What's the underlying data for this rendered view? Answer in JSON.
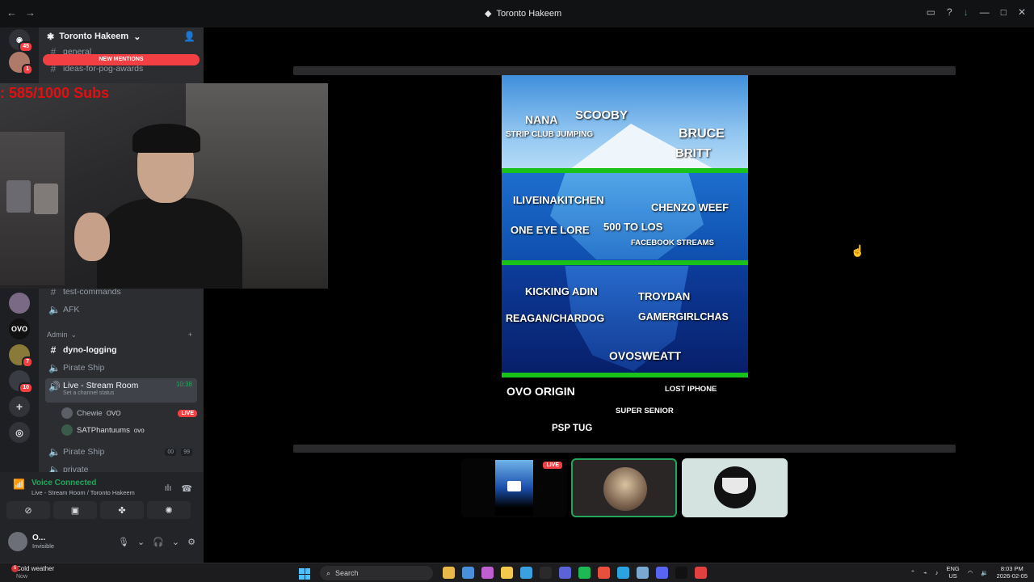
{
  "window": {
    "title": "Toronto Hakeem",
    "nav_back": "←",
    "nav_forward": "→"
  },
  "rail": {
    "badges": [
      "45",
      "1",
      "7",
      "10"
    ],
    "ovo_label": "OVO"
  },
  "sidebar": {
    "server_name": "Toronto Hakeem",
    "new_mentions": "NEW MENTIONS",
    "channels_top": [
      "general",
      "ideas-for-pog-awards"
    ],
    "channels_mid": [
      {
        "name": "test-commands",
        "type": "text"
      },
      {
        "name": "AFK",
        "type": "voice"
      }
    ],
    "admin_category": "Admin",
    "admin_channels": [
      {
        "name": "dyno-logging",
        "type": "text"
      },
      {
        "name": "Pirate Ship",
        "type": "voice"
      }
    ],
    "live_room": {
      "name": "Live - Stream Room",
      "time": "10:38",
      "status": "Set a channel status",
      "users": [
        {
          "name": "Chewie",
          "tag": "OVO",
          "live": "LIVE"
        },
        {
          "name": "SATPhantuums",
          "tag": "ovo"
        }
      ]
    },
    "after_channels": [
      {
        "name": "Pirate Ship",
        "type": "voice",
        "count_a": "00",
        "count_b": "99"
      },
      {
        "name": "private",
        "type": "voice"
      }
    ]
  },
  "voice": {
    "status": "Voice Connected",
    "location": "Live - Stream Room / Toronto Hakeem"
  },
  "user": {
    "name": "O...",
    "status": "Invisible"
  },
  "webcam": {
    "subs_text": ": 585/1000  Subs"
  },
  "iceberg": {
    "labels": [
      {
        "text": "NANA",
        "size": 14
      },
      {
        "text": "SCOOBY",
        "size": 15
      },
      {
        "text": "STRIP CLUB JUMPING",
        "size": 10
      },
      {
        "text": "BRUCE",
        "size": 16
      },
      {
        "text": "BRITT",
        "size": 15
      },
      {
        "text": "ILIVEINAKITCHEN",
        "size": 13
      },
      {
        "text": "CHENZO WEEF",
        "size": 13
      },
      {
        "text": "500 TO LOS",
        "size": 13
      },
      {
        "text": "ONE EYE LORE",
        "size": 13
      },
      {
        "text": "FACEBOOK STREAMS",
        "size": 9.5
      },
      {
        "text": "KICKING ADIN",
        "size": 13
      },
      {
        "text": "TROYDAN",
        "size": 13
      },
      {
        "text": "REAGAN/CHARDOG",
        "size": 12.5
      },
      {
        "text": "GAMERGIRLCHAS",
        "size": 12.5
      },
      {
        "text": "OVOSWEATT",
        "size": 14
      },
      {
        "text": "OVO ORIGIN",
        "size": 14
      },
      {
        "text": "LOST IPHONE",
        "size": 9.5
      },
      {
        "text": "SUPER SENIOR",
        "size": 9.5
      },
      {
        "text": "PSP TUG",
        "size": 11.5
      }
    ]
  },
  "thumbnails": {
    "live_label": "LIVE"
  },
  "taskbar": {
    "weather_badge": "6",
    "weather_text": "Cold weather",
    "weather_sub": "Now",
    "search_placeholder": "Search",
    "lang_top": "ENG",
    "lang_bottom": "US",
    "time": "8:03 PM",
    "date": "2026-02-05",
    "app_colors": [
      "#e8b84a",
      "#4a8fd9",
      "#c060d0",
      "#f2c94c",
      "#3aa0e0",
      "#2a2a2a",
      "#5b63d6",
      "#1db954",
      "#e84f3d",
      "#2aa3e0",
      "#7aa8d0",
      "#5865f2",
      "#111111",
      "#e04040"
    ]
  }
}
